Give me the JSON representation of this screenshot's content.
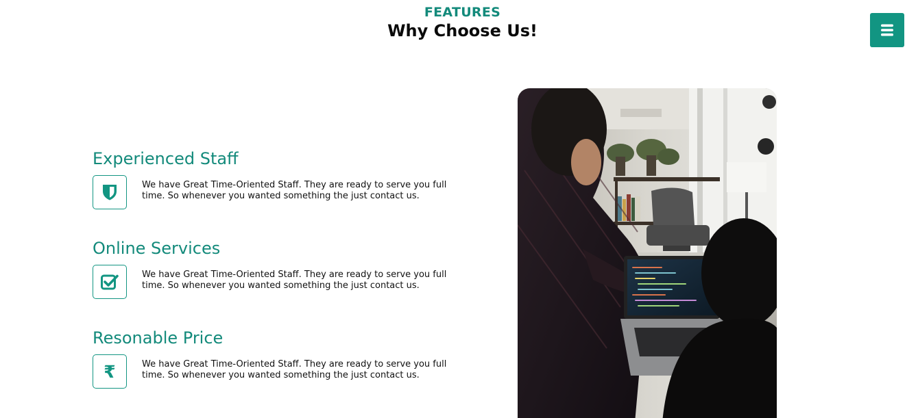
{
  "header": {
    "eyebrow": "FEATURES",
    "title": "Why Choose Us!"
  },
  "menu": {
    "icon": "hamburger-menu-icon",
    "color": "#129582"
  },
  "features": [
    {
      "title": "Experienced Staff",
      "icon": "shield-icon",
      "description": "We have Great Time-Oriented Staff. They are ready to serve you full time. So whenever you wanted something the just contact us."
    },
    {
      "title": "Online Services",
      "icon": "check-square-icon",
      "description": "We have Great Time-Oriented Staff. They are ready to serve you full time. So whenever you wanted something the just contact us."
    },
    {
      "title": "Resonable Price",
      "icon": "rupee-icon",
      "description": "We have Great Time-Oriented Staff. They are ready to serve you full time. So whenever you wanted something the just contact us."
    }
  ],
  "photo": {
    "subject": "two-people-looking-at-laptop-code-photo"
  },
  "colors": {
    "accent": "#129582",
    "accent_text": "#138a7b",
    "heading": "#0a0a0a",
    "body_text": "#111111"
  }
}
